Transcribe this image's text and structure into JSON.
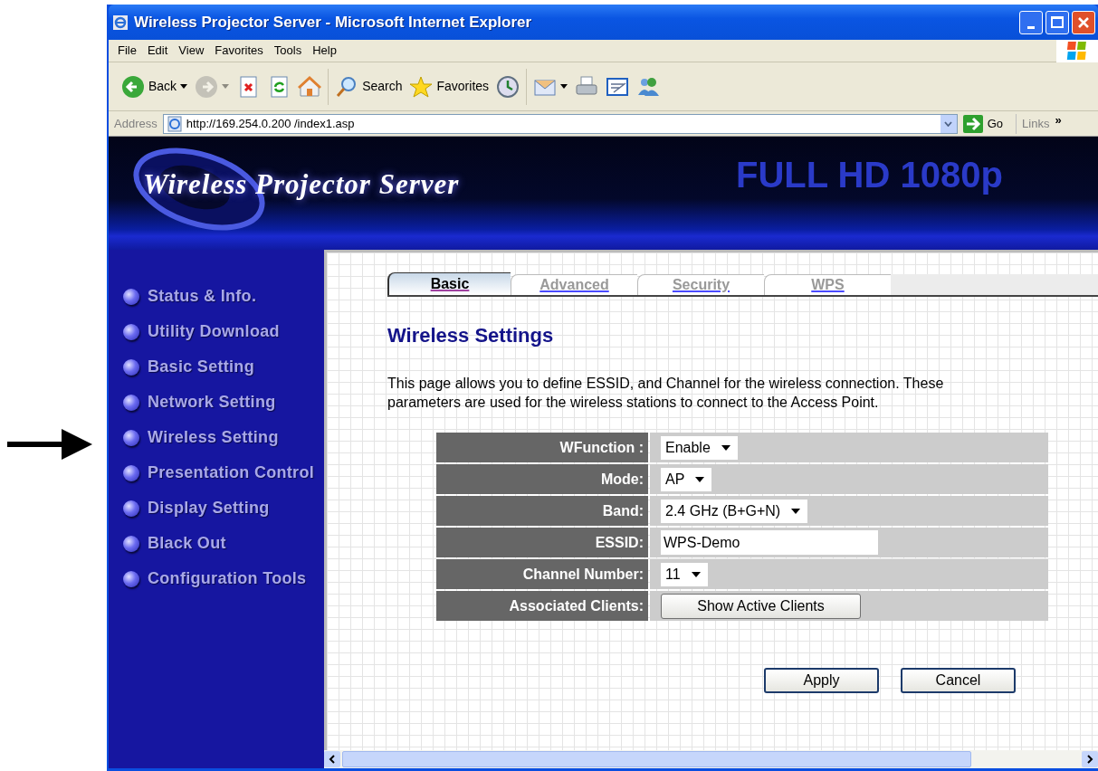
{
  "window": {
    "title": "Wireless Projector Server - Microsoft Internet Explorer"
  },
  "menu": [
    "File",
    "Edit",
    "View",
    "Favorites",
    "Tools",
    "Help"
  ],
  "toolbar": [
    {
      "kind": "back",
      "label": "Back",
      "disabled": false
    },
    {
      "kind": "forward",
      "disabled": true
    },
    {
      "kind": "stop",
      "disabled": false
    },
    {
      "kind": "refresh",
      "disabled": false
    },
    {
      "kind": "home",
      "disabled": false
    },
    {
      "kind": "search",
      "label": "Search",
      "disabled": false
    },
    {
      "kind": "favorites",
      "label": "Favorites",
      "disabled": false
    },
    {
      "kind": "history",
      "disabled": false
    },
    {
      "kind": "mail",
      "disabled": false
    },
    {
      "kind": "print",
      "disabled": false
    },
    {
      "kind": "edit",
      "disabled": false
    },
    {
      "kind": "messenger",
      "disabled": false
    }
  ],
  "address": {
    "label": "Address",
    "url": "http://169.254.0.200 /index1.asp",
    "go": "Go",
    "links": "Links",
    "more": "»"
  },
  "banner": {
    "title": "Wireless Projector Server",
    "tagline": "FULL HD 1080p"
  },
  "sidebar": {
    "items": [
      "Status & Info.",
      "Utility Download",
      "Basic Setting",
      "Network Setting",
      "Wireless Setting",
      "Presentation Control",
      "Display Setting",
      "Black Out",
      "Configuration Tools"
    ]
  },
  "tabs": [
    {
      "label": "Basic",
      "selected": true
    },
    {
      "label": "Advanced",
      "selected": false
    },
    {
      "label": "Security",
      "selected": false
    },
    {
      "label": "WPS",
      "selected": false
    }
  ],
  "heading": "Wireless Settings",
  "description": "This page allows you to define ESSID, and Channel for the wireless connection. These parameters are used for the wireless stations to connect to the Access Point.",
  "form": [
    {
      "label": "WFunction :",
      "kind": "select",
      "value": "Enable"
    },
    {
      "label": "Mode:",
      "kind": "select",
      "value": "AP"
    },
    {
      "label": "Band:",
      "kind": "select",
      "value": "2.4 GHz (B+G+N)"
    },
    {
      "label": "ESSID:",
      "kind": "text",
      "value": "WPS-Demo"
    },
    {
      "label": "Channel Number:",
      "kind": "select",
      "value": "11"
    },
    {
      "label": "Associated Clients:",
      "kind": "button",
      "value": "Show Active Clients"
    }
  ],
  "buttons": [
    "Apply",
    "Cancel"
  ]
}
